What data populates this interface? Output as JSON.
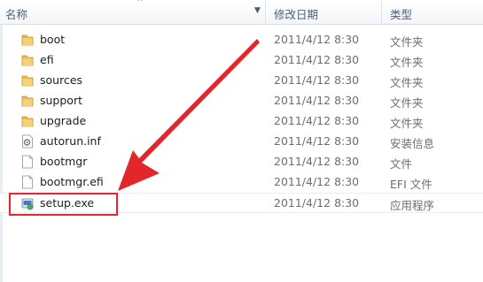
{
  "columns": {
    "name": "名称",
    "date": "修改日期",
    "type": "类型"
  },
  "files": [
    {
      "name": "boot",
      "date": "2011/4/12 8:30",
      "type": "文件夹",
      "icon": "folder-icon"
    },
    {
      "name": "efi",
      "date": "2011/4/12 8:30",
      "type": "文件夹",
      "icon": "folder-icon"
    },
    {
      "name": "sources",
      "date": "2011/4/12 8:30",
      "type": "文件夹",
      "icon": "folder-icon"
    },
    {
      "name": "support",
      "date": "2011/4/12 8:30",
      "type": "文件夹",
      "icon": "folder-icon"
    },
    {
      "name": "upgrade",
      "date": "2011/4/12 8:30",
      "type": "文件夹",
      "icon": "folder-icon"
    },
    {
      "name": "autorun.inf",
      "date": "2011/4/12 8:30",
      "type": "安装信息",
      "icon": "settings-file-icon"
    },
    {
      "name": "bootmgr",
      "date": "2011/4/12 8:30",
      "type": "文件",
      "icon": "blank-file-icon"
    },
    {
      "name": "bootmgr.efi",
      "date": "2011/4/12 8:30",
      "type": "EFI 文件",
      "icon": "blank-file-icon"
    },
    {
      "name": "setup.exe",
      "date": "2011/4/12 8:30",
      "type": "应用程序",
      "icon": "setup-app-icon"
    }
  ],
  "colors": {
    "highlight": "#e3262b",
    "folder": "#e8b84a",
    "header_text": "#4c607a"
  }
}
